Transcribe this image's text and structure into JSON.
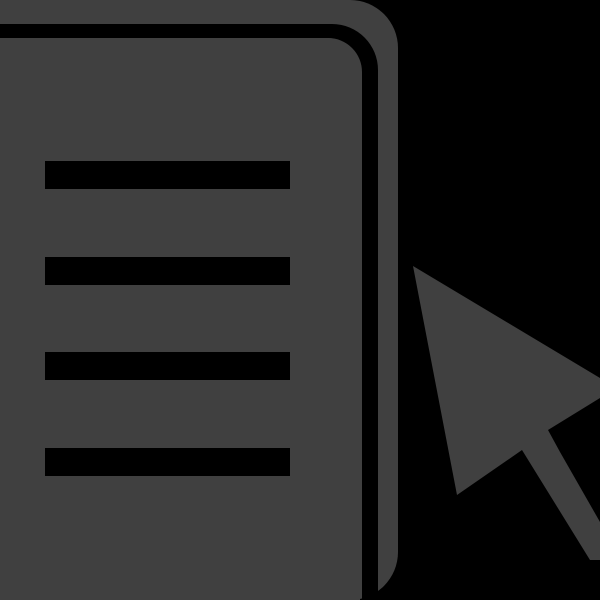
{
  "icon": {
    "name": "document-click-icon",
    "parts": {
      "document": "document-icon",
      "text_lines": [
        "text-line-icon",
        "text-line-icon",
        "text-line-icon",
        "text-line-icon"
      ],
      "cursor": "cursor-arrow-icon"
    }
  },
  "colors": {
    "background": "#000000",
    "foreground": "#404040"
  }
}
